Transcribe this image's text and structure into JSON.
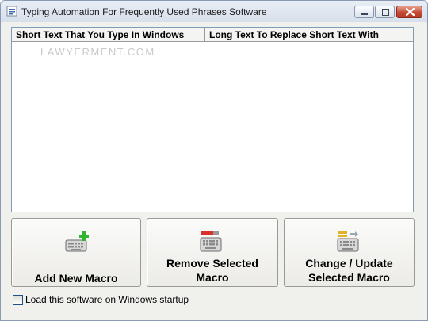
{
  "window": {
    "title": "Typing Automation For Frequently Used Phrases Software",
    "icon": "app-icon",
    "controls": [
      "minimize-icon",
      "maximize-icon",
      "close-icon"
    ]
  },
  "list": {
    "columns": [
      "Short Text That You Type In Windows",
      "Long Text To Replace Short Text With"
    ],
    "rows": [],
    "watermark": "LAWYERMENT.COM"
  },
  "buttons": {
    "add": {
      "line1": "Add New Macro",
      "icon": "keyboard-add-icon"
    },
    "remove": {
      "line1": "Remove Selected",
      "line2": "Macro",
      "icon": "keyboard-remove-icon"
    },
    "change": {
      "line1": "Change / Update",
      "line2": "Selected Macro",
      "icon": "keyboard-update-icon"
    }
  },
  "startup": {
    "label": "Load this software on Windows startup",
    "checked": false
  },
  "colors": {
    "titlebar": "#dbe3ee",
    "window_bg": "#f0f0ec",
    "close_button": "#c44a33",
    "list_border": "#7f9db9"
  }
}
